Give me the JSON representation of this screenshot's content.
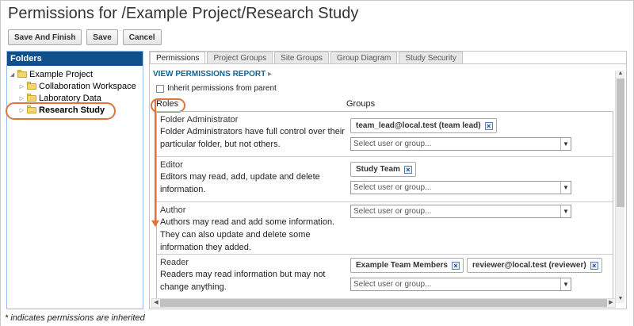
{
  "page": {
    "title": "Permissions for /Example Project/Research Study"
  },
  "toolbar": {
    "save_finish": "Save And Finish",
    "save": "Save",
    "cancel": "Cancel"
  },
  "folders": {
    "header": "Folders",
    "root": "Example Project",
    "children": [
      {
        "label": "Collaboration Workspace"
      },
      {
        "label": "Laboratory Data"
      },
      {
        "label": "Research Study",
        "selected": true
      }
    ]
  },
  "tabs": [
    {
      "label": "Permissions",
      "active": true
    },
    {
      "label": "Project Groups"
    },
    {
      "label": "Site Groups"
    },
    {
      "label": "Group Diagram"
    },
    {
      "label": "Study Security"
    }
  ],
  "permissions": {
    "report_link": "VIEW PERMISSIONS REPORT",
    "report_arrow": "▸",
    "inherit_label": "Inherit permissions from parent",
    "roles_header": "Roles",
    "groups_header": "Groups",
    "select_placeholder": "Select user or group...",
    "roles": [
      {
        "name": "Folder Administrator",
        "desc": "Folder Administrators have full control over their particular folder, but not others.",
        "members": [
          "team_lead@local.test (team lead)"
        ]
      },
      {
        "name": "Editor",
        "desc": "Editors may read, add, update and delete information.",
        "members": [
          "Study Team"
        ]
      },
      {
        "name": "Author",
        "desc": "Authors may read and add some information. They can also update and delete some information they added.",
        "members": []
      },
      {
        "name": "Reader",
        "desc": "Readers may read information but may not change anything.",
        "members": [
          "Example Team Members",
          "reviewer@local.test (reviewer)"
        ]
      }
    ]
  },
  "footnote": "* indicates permissions are inherited",
  "colors": {
    "accent": "#e0743a",
    "folder_header": "#10508a",
    "link": "#126495"
  }
}
